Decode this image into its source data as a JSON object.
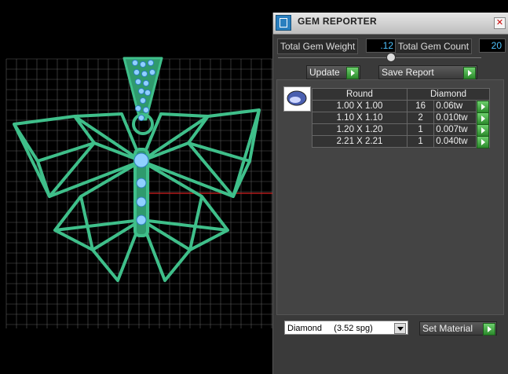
{
  "window": {
    "title": "GEM REPORTER",
    "close_label": "✕"
  },
  "summary": {
    "weight_label": "Total Gem Weight",
    "weight_value": ".12",
    "count_label": "Total Gem Count",
    "count_value": "20"
  },
  "toolbar": {
    "update_label": "Update",
    "save_report_label": "Save Report"
  },
  "gem_table": {
    "shape_header": "Round",
    "material_header": "Diamond",
    "rows": [
      {
        "size": "1.00 X 1.00",
        "count": "16",
        "weight": "0.06tw"
      },
      {
        "size": "1.10 X 1.10",
        "count": "2",
        "weight": "0.010tw"
      },
      {
        "size": "1.20 X 1.20",
        "count": "1",
        "weight": "0.007tw"
      },
      {
        "size": "2.21 X 2.21",
        "count": "1",
        "weight": "0.040tw"
      }
    ]
  },
  "material": {
    "selected": "Diamond     (3.52 spg)",
    "set_label": "Set Material"
  },
  "colors": {
    "model": "#3fbf8a",
    "grid": "#5a5a5a",
    "gem": "#8fd0ff",
    "axis": "#d21f1f"
  },
  "icons": {
    "title": "gem-reporter-icon",
    "thumb": "round-gem-icon"
  }
}
